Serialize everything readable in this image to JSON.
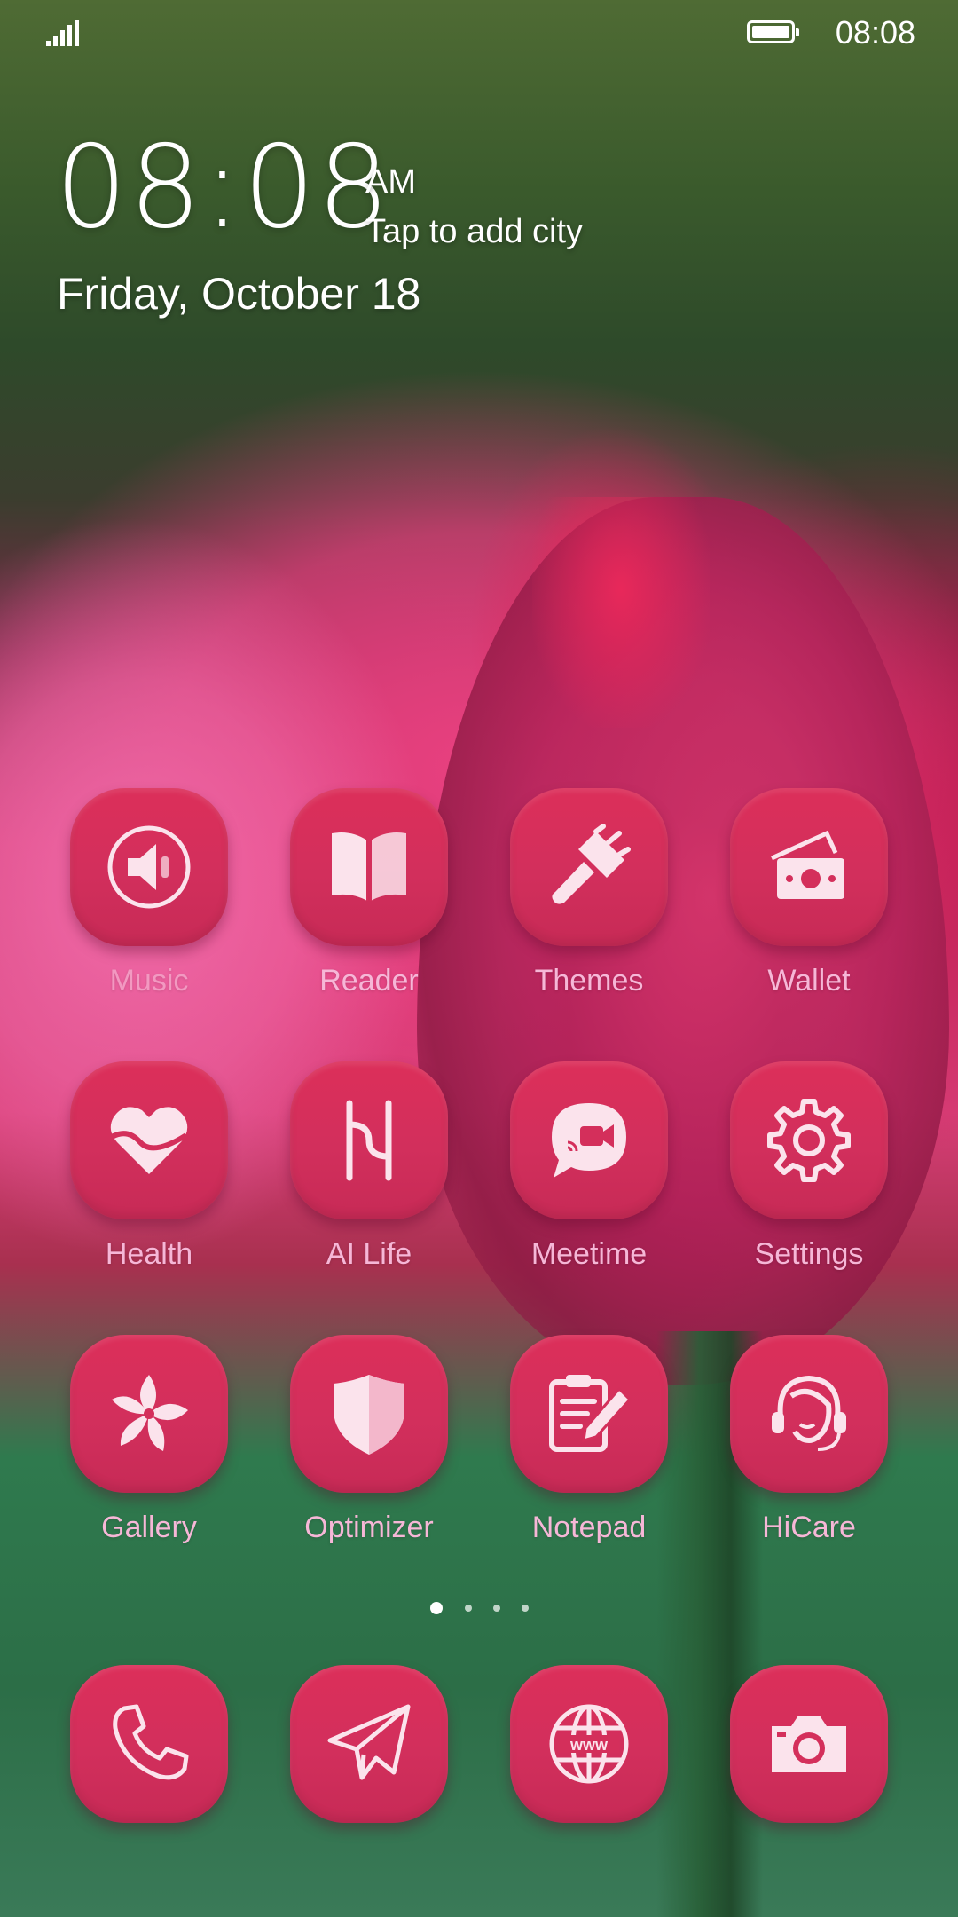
{
  "status_bar": {
    "time": "08:08",
    "signal_icon": "signal-bars-icon",
    "battery_icon": "battery-full-icon"
  },
  "clock_widget": {
    "time": "08:08",
    "ampm": "AM",
    "city_prompt": "Tap to add city",
    "date": "Friday, October 18"
  },
  "apps": [
    {
      "label": "Music",
      "icon": "speaker-icon"
    },
    {
      "label": "Reader",
      "icon": "book-icon"
    },
    {
      "label": "Themes",
      "icon": "paintbrush-icon"
    },
    {
      "label": "Wallet",
      "icon": "wallet-money-icon"
    },
    {
      "label": "Health",
      "icon": "heart-icon"
    },
    {
      "label": "AI Life",
      "icon": "ai-life-icon"
    },
    {
      "label": "Meetime",
      "icon": "video-chat-icon"
    },
    {
      "label": "Settings",
      "icon": "gear-icon"
    },
    {
      "label": "Gallery",
      "icon": "flower-icon"
    },
    {
      "label": "Optimizer",
      "icon": "shield-icon"
    },
    {
      "label": "Notepad",
      "icon": "notepad-pencil-icon"
    },
    {
      "label": "HiCare",
      "icon": "headset-icon"
    }
  ],
  "page_indicator": {
    "pages": 4,
    "current": 1
  },
  "dock": [
    {
      "icon": "phone-icon"
    },
    {
      "icon": "paper-plane-icon"
    },
    {
      "icon": "browser-globe-icon"
    },
    {
      "icon": "camera-icon"
    }
  ],
  "colors": {
    "tile": "#d42f5b",
    "label": "#f6b7d7",
    "icon": "#fbe3ec"
  }
}
